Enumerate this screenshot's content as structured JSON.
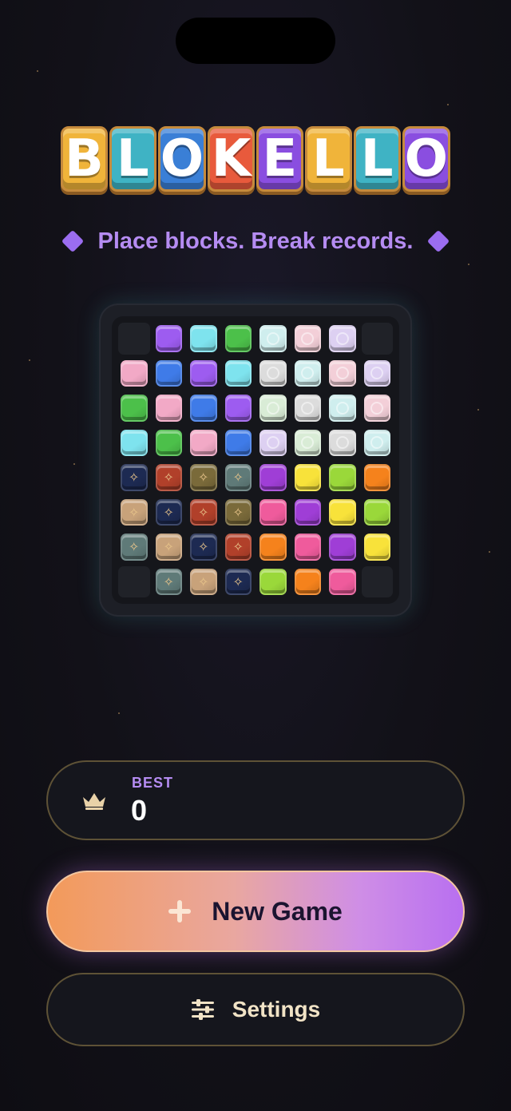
{
  "logo": {
    "letters": [
      "B",
      "L",
      "O",
      "K",
      "E",
      "L",
      "L",
      "O"
    ],
    "letter_colors": [
      "#f0b43a",
      "#3fb3c4",
      "#3a7fd6",
      "#e85a3c",
      "#8a4ee0",
      "#f0b43a",
      "#3fb3c4",
      "#8a4ee0"
    ]
  },
  "tagline": "Place blocks. Break records.",
  "board": {
    "rows": [
      [
        "empty",
        "purple",
        "cyan",
        "green",
        "pale-cyan",
        "pale-pink",
        "pale-lilac",
        "empty"
      ],
      [
        "pink",
        "blue",
        "purple",
        "cyan",
        "pale-grey",
        "pale-cyan",
        "pale-pink",
        "pale-lilac"
      ],
      [
        "green",
        "pink",
        "blue",
        "purple",
        "pale-mint",
        "pale-grey",
        "pale-cyan",
        "pale-pink"
      ],
      [
        "cyan",
        "green",
        "pink",
        "blue",
        "pale-lilac",
        "pale-mint",
        "pale-grey",
        "pale-cyan"
      ],
      [
        "ornate-navy",
        "ornate-rust",
        "ornate-olive",
        "ornate-slate",
        "violet",
        "yellow",
        "lime",
        "orange"
      ],
      [
        "ornate-sand",
        "ornate-navy",
        "ornate-rust",
        "ornate-olive",
        "magenta",
        "violet",
        "yellow",
        "lime"
      ],
      [
        "ornate-slate",
        "ornate-sand",
        "ornate-navy",
        "ornate-rust",
        "orange",
        "magenta",
        "violet",
        "yellow"
      ],
      [
        "empty",
        "ornate-slate",
        "ornate-sand",
        "ornate-navy",
        "lime",
        "orange",
        "magenta",
        "empty"
      ]
    ],
    "colors": {
      "purple": "#9d5cf0",
      "cyan": "#7ee3ee",
      "green": "#4cc04a",
      "pink": "#f2a9c6",
      "blue": "#3f7be8",
      "pale-cyan": "#cfeeee",
      "pale-pink": "#f3cfd8",
      "pale-lilac": "#ddd0f2",
      "pale-grey": "#dcdcdc",
      "pale-mint": "#d9ecd6",
      "ornate-navy": "#1d2a52",
      "ornate-rust": "#b1402a",
      "ornate-olive": "#7a6a3a",
      "ornate-slate": "#5f7a78",
      "ornate-sand": "#c8a27a",
      "violet": "#9f3ed6",
      "yellow": "#f8e23a",
      "lime": "#9ad83a",
      "orange": "#f5821c",
      "magenta": "#ef5b9c"
    }
  },
  "best": {
    "label": "BEST",
    "value": "0",
    "icon": "crown-icon"
  },
  "buttons": {
    "new_game": {
      "label": "New Game",
      "icon": "plus-icon"
    },
    "settings": {
      "label": "Settings",
      "icon": "sliders-icon"
    }
  },
  "theme": {
    "accent": "#b58cf2",
    "gold": "#c58a3c"
  }
}
